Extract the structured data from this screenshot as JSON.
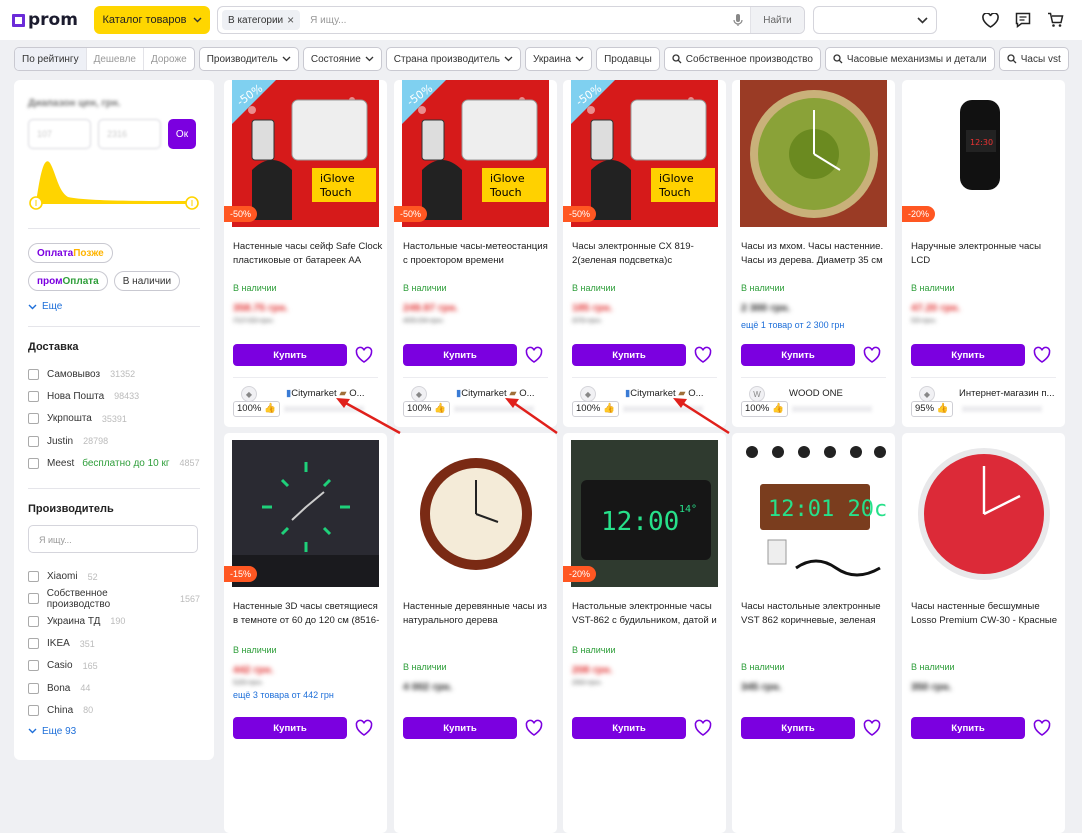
{
  "header": {
    "logo": "prom",
    "catalog_button": "Каталог товаров",
    "search_category": "В категории",
    "search_placeholder": "Я ищу...",
    "search_button": "Найти",
    "brand_color": "#7b00e0",
    "icons": [
      "heart-icon",
      "chat-icon",
      "cart-icon"
    ]
  },
  "filters": {
    "sort": [
      "По рейтингу",
      "Дешевле",
      "Дороже"
    ],
    "chips": [
      "Производитель",
      "Состояние",
      "Страна производитель",
      "Украина",
      "Продавцы",
      "Собственное производство",
      "Часовые механизмы и детали",
      "Часы vst"
    ]
  },
  "sidebar": {
    "price_label": "Диапазон цен, грн.",
    "price_min": "107",
    "price_max": "2316",
    "ok": "Ок",
    "pay_later_a": "Оплата",
    "pay_later_b": "Позже",
    "prom_pay_a": "пром",
    "prom_pay_b": "Оплата",
    "in_stock": "В наличии",
    "more": "Еще",
    "delivery_title": "Доставка",
    "delivery": [
      {
        "label": "Самовывоз",
        "count": "31352"
      },
      {
        "label": "Нова Пошта",
        "count": "98433"
      },
      {
        "label": "Укрпошта",
        "count": "35391"
      },
      {
        "label": "Justin",
        "count": "28798"
      },
      {
        "label": "Meest",
        "note": "бесплатно до 10 кг",
        "count": "4857"
      }
    ],
    "maker_title": "Производитель",
    "maker_placeholder": "Я ищу...",
    "makers": [
      {
        "label": "Xiaomi",
        "count": "52"
      },
      {
        "label": "Собственное производство",
        "count": "1567"
      },
      {
        "label": "Украина ТД",
        "count": "190"
      },
      {
        "label": "IKEA",
        "count": "351"
      },
      {
        "label": "Casio",
        "count": "165"
      },
      {
        "label": "Bona",
        "count": "44"
      },
      {
        "label": "China",
        "count": "80"
      }
    ],
    "more93": "Еще 93"
  },
  "products": [
    {
      "discount": "-50%",
      "title": "Настенные часы сейф Safe Clock пластиковые от батареек АА",
      "avail": "В наличии",
      "price": "358.75 грн.",
      "old": "717.50 грн.",
      "buy": "Купить",
      "shop": "Citymarket",
      "shop_tail": "О...",
      "rating": "100%",
      "img": "iglove"
    },
    {
      "discount": "-50%",
      "title": "Настольные часы-метеостанция с проектором времени",
      "avail": "В наличии",
      "price": "249.97 грн.",
      "old": "499.94 грн.",
      "buy": "Купить",
      "shop": "Citymarket",
      "shop_tail": "О...",
      "rating": "100%",
      "img": "iglove"
    },
    {
      "discount": "-50%",
      "title": "Часы электронные CX 819-2(зеленая подсветка)с",
      "avail": "В наличии",
      "price": "185 грн.",
      "old": "370 грн.",
      "buy": "Купить",
      "shop": "Citymarket",
      "shop_tail": "О...",
      "rating": "100%",
      "img": "iglove"
    },
    {
      "discount": "",
      "title": "Часы из мхом. Часы настенние. Часы из дерева. Диаметр 35 см",
      "avail": "В наличии",
      "price": "2 300 грн.",
      "old": "",
      "extra": "ещё 1 товар от 2 300 грн",
      "buy": "Купить",
      "shop": "WOOD ONE",
      "shop_tail": "",
      "rating": "100%",
      "img": "moss"
    },
    {
      "discount": "-20%",
      "title": "Наручные электронные часы LCD",
      "avail": "В наличии",
      "price": "47.20 грн.",
      "old": "59 грн.",
      "buy": "Купить",
      "shop": "Интернет-магазин п...",
      "shop_tail": "",
      "rating": "95%",
      "img": "watch"
    },
    {
      "discount": "-15%",
      "title": "Настенные 3D часы светящиеся в темноте от 60 до 120 см (8516-",
      "avail": "В наличии",
      "price": "442 грн.",
      "old": "520 грн.",
      "extra": "ещё 3 товара от 442 грн",
      "buy": "Купить",
      "img": "3d"
    },
    {
      "discount": "",
      "title": "Настенные деревянные часы из натурального дерева",
      "avail": "В наличии",
      "price": "4 002 грн.",
      "old": "",
      "buy": "Купить",
      "img": "wood"
    },
    {
      "discount": "-20%",
      "title": "Настольные электронные часы VST-862 с будильником, датой и",
      "avail": "В наличии",
      "price": "208 грн.",
      "old": "260 грн.",
      "buy": "Купить",
      "img": "vst"
    },
    {
      "discount": "",
      "title": "Часы настольные электронные VST 862 коричневые, зеленая",
      "avail": "В наличии",
      "price": "345 грн.",
      "old": "",
      "buy": "Купить",
      "img": "brown"
    },
    {
      "discount": "",
      "title": "Часы настенные бесшумные Losso Premium CW-30 - Красные",
      "avail": "В наличии",
      "price": "350 грн.",
      "old": "",
      "buy": "Купить",
      "img": "red"
    }
  ]
}
